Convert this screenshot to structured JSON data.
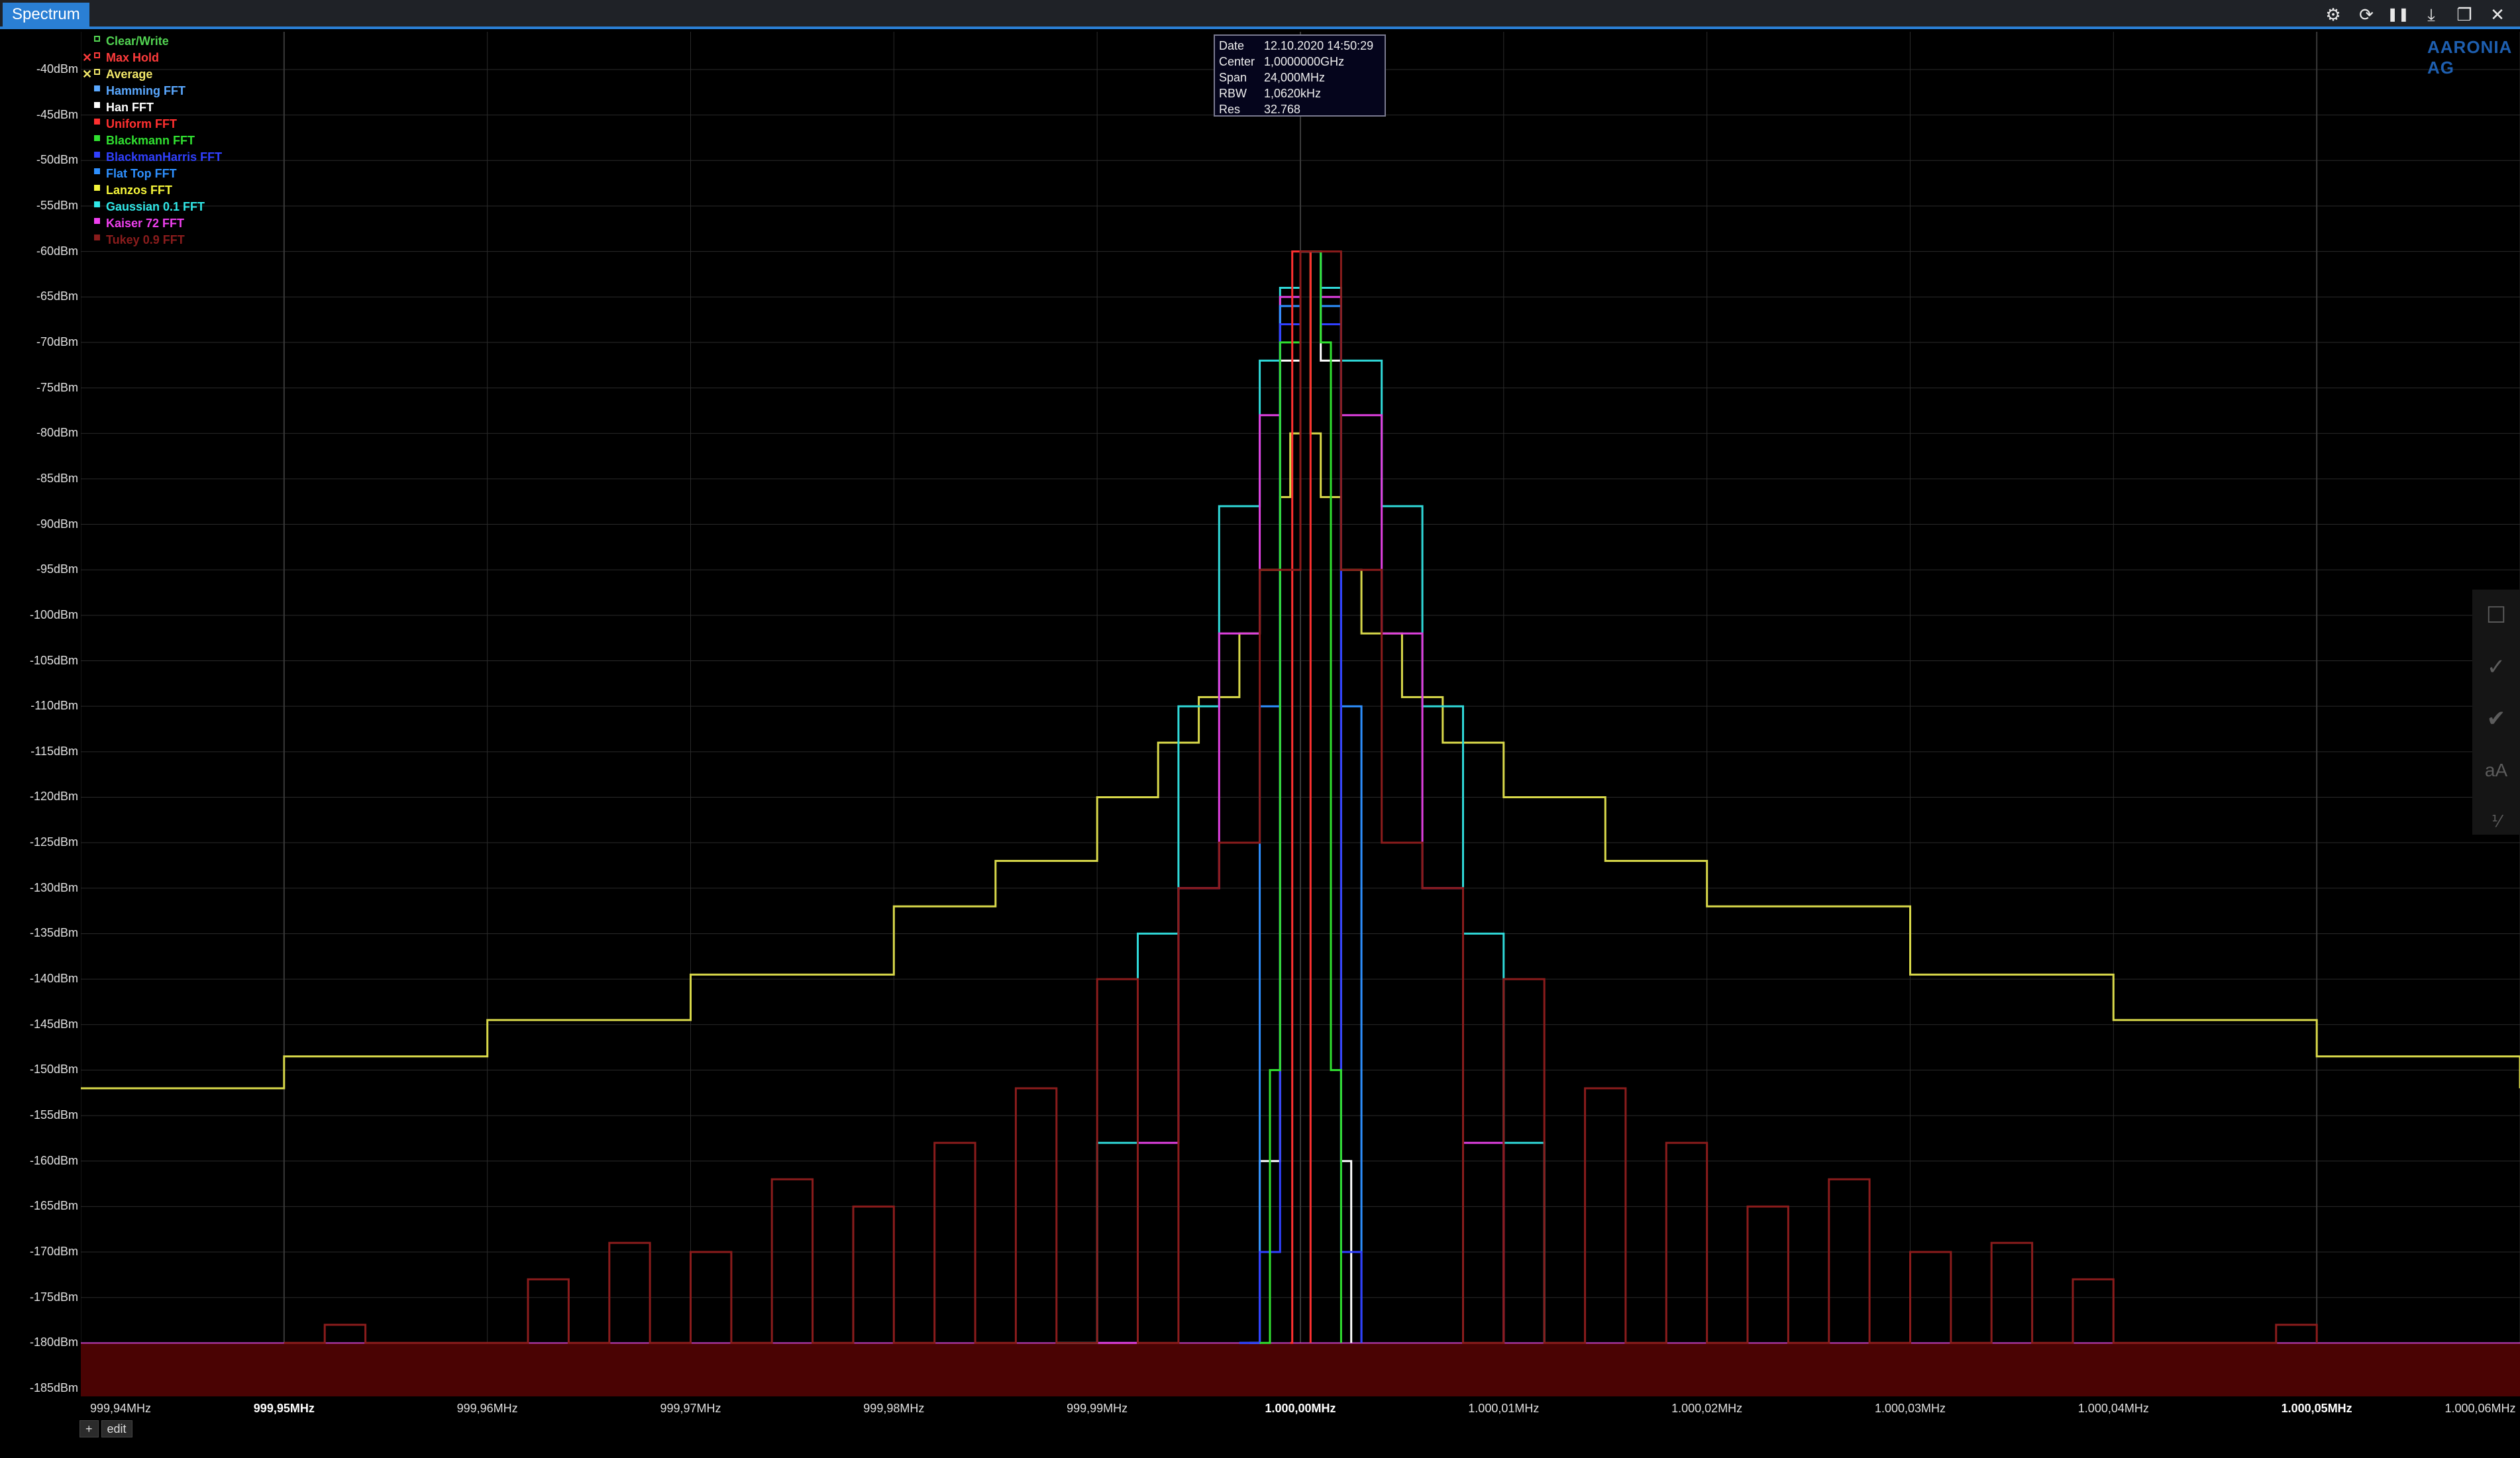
{
  "window": {
    "tab_label": "Spectrum"
  },
  "toolbar": {
    "buttons": [
      {
        "name": "settings-icon",
        "glyph": "⚙"
      },
      {
        "name": "refresh-icon",
        "glyph": "⟳"
      },
      {
        "name": "pause-icon",
        "glyph": "❚❚"
      },
      {
        "name": "download-icon",
        "glyph": "⤓"
      },
      {
        "name": "window-icon",
        "glyph": "❐"
      },
      {
        "name": "close-icon",
        "glyph": "✕"
      }
    ]
  },
  "info_box": {
    "rows": [
      {
        "key": "Date",
        "value": "12.10.2020 14:50:29"
      },
      {
        "key": "Center",
        "value": "1,0000000GHz"
      },
      {
        "key": "Span",
        "value": "24,000MHz"
      },
      {
        "key": "RBW",
        "value": "1,0620kHz"
      },
      {
        "key": "Res",
        "value": "32.768"
      }
    ]
  },
  "logo_text": "AARONIA AG",
  "side_tools": [
    "marker-box-icon",
    "trace-check-icon",
    "fill-check-icon",
    "font-size-icon",
    "fraction-icon"
  ],
  "bottom": {
    "add_label": "+",
    "edit_label": "edit"
  },
  "chart_data": {
    "type": "line",
    "ylim": [
      -187,
      -37
    ],
    "yticks": [
      "-40dBm",
      "-45dBm",
      "-50dBm",
      "-55dBm",
      "-60dBm",
      "-65dBm",
      "-70dBm",
      "-75dBm",
      "-80dBm",
      "-85dBm",
      "-90dBm",
      "-95dBm",
      "-100dBm",
      "-105dBm",
      "-110dBm",
      "-115dBm",
      "-120dBm",
      "-125dBm",
      "-130dBm",
      "-135dBm",
      "-140dBm",
      "-145dBm",
      "-150dBm",
      "-155dBm",
      "-160dBm",
      "-165dBm",
      "-170dBm",
      "-175dBm",
      "-180dBm",
      "-185dBm"
    ],
    "ytick_values": [
      -40,
      -45,
      -50,
      -55,
      -60,
      -65,
      -70,
      -75,
      -80,
      -85,
      -90,
      -95,
      -100,
      -105,
      -110,
      -115,
      -120,
      -125,
      -130,
      -135,
      -140,
      -145,
      -150,
      -155,
      -160,
      -165,
      -170,
      -175,
      -180,
      -185
    ],
    "xlim": [
      999.94,
      1000.06
    ],
    "xticks": [
      {
        "v": 999.94,
        "label": "999,94MHz",
        "bold": false
      },
      {
        "v": 999.95,
        "label": "999,95MHz",
        "bold": true
      },
      {
        "v": 999.96,
        "label": "999,96MHz",
        "bold": false
      },
      {
        "v": 999.97,
        "label": "999,97MHz",
        "bold": false
      },
      {
        "v": 999.98,
        "label": "999,98MHz",
        "bold": false
      },
      {
        "v": 999.99,
        "label": "999,99MHz",
        "bold": false
      },
      {
        "v": 1000.0,
        "label": "1.000,00MHz",
        "bold": true
      },
      {
        "v": 1000.01,
        "label": "1.000,01MHz",
        "bold": false
      },
      {
        "v": 1000.02,
        "label": "1.000,02MHz",
        "bold": false
      },
      {
        "v": 1000.03,
        "label": "1.000,03MHz",
        "bold": false
      },
      {
        "v": 1000.04,
        "label": "1.000,04MHz",
        "bold": false
      },
      {
        "v": 1000.05,
        "label": "1.000,05MHz",
        "bold": true
      },
      {
        "v": 1000.06,
        "label": "1.000,06MHz",
        "bold": false
      }
    ],
    "grid": true,
    "legend_position": "top-left",
    "floor_dbm": -180,
    "legend": [
      {
        "name": "Clear/Write",
        "color": "#52d452",
        "marker": "□"
      },
      {
        "name": "Max Hold",
        "color": "#ff3b3b",
        "marker": "□",
        "x": "✕"
      },
      {
        "name": "Average",
        "color": "#f2e86a",
        "marker": "□",
        "x": "✕"
      },
      {
        "name": "Hamming FFT",
        "color": "#5aa8ff",
        "marker": "■"
      },
      {
        "name": "Han FFT",
        "color": "#ffffff",
        "marker": "■"
      },
      {
        "name": "Uniform FFT",
        "color": "#ff3030",
        "marker": "■"
      },
      {
        "name": "Blackmann FFT",
        "color": "#30e030",
        "marker": "■"
      },
      {
        "name": "BlackmanHarris FFT",
        "color": "#3040ff",
        "marker": "■"
      },
      {
        "name": "Flat Top FFT",
        "color": "#2e90ff",
        "marker": "■"
      },
      {
        "name": "Lanzos FFT",
        "color": "#f5f53a",
        "marker": "■"
      },
      {
        "name": "Gaussian 0.1 FFT",
        "color": "#30e8e8",
        "marker": "■"
      },
      {
        "name": "Kaiser 72 FFT",
        "color": "#f040f0",
        "marker": "■"
      },
      {
        "name": "Tukey 0.9 FFT",
        "color": "#8a1c1c",
        "marker": "■"
      }
    ],
    "series": [
      {
        "name": "Lanzos FFT",
        "color": "#d8d84a",
        "x": [
          999.94,
          999.95,
          999.96,
          999.97,
          999.98,
          999.985,
          999.99,
          999.993,
          999.995,
          999.997,
          999.998,
          999.999,
          999.9995,
          1000.0,
          1000.0005,
          1000.001,
          1000.002,
          1000.003,
          1000.005,
          1000.007,
          1000.01,
          1000.015,
          1000.02,
          1000.03,
          1000.04,
          1000.05,
          1000.06
        ],
        "y": [
          -152,
          -148.5,
          -144.5,
          -139.5,
          -132,
          -127,
          -120,
          -114,
          -109,
          -102,
          -95,
          -87,
          -80,
          -60,
          -80,
          -87,
          -95,
          -102,
          -109,
          -114,
          -120,
          -127,
          -132,
          -139.5,
          -144.5,
          -148.5,
          -152
        ]
      },
      {
        "name": "Gaussian 0.1 FFT",
        "color": "#30d8d8",
        "x": [
          999.988,
          999.99,
          999.992,
          999.994,
          999.996,
          999.998,
          999.999,
          1000.0,
          1000.001,
          1000.002,
          1000.004,
          1000.006,
          1000.008,
          1000.01,
          1000.012
        ],
        "y": [
          -180,
          -158,
          -135,
          -110,
          -88,
          -72,
          -64,
          -60,
          -64,
          -72,
          -88,
          -110,
          -135,
          -158,
          -180
        ]
      },
      {
        "name": "Kaiser 72 FFT",
        "color": "#e040e0",
        "x": [
          999.99,
          999.992,
          999.994,
          999.996,
          999.998,
          999.999,
          1000.0,
          1000.001,
          1000.002,
          1000.004,
          1000.006,
          1000.008,
          1000.01
        ],
        "y": [
          -180,
          -158,
          -130,
          -102,
          -78,
          -65,
          -60,
          -65,
          -78,
          -102,
          -130,
          -158,
          -180
        ]
      },
      {
        "name": "Han FFT",
        "color": "#ffffff",
        "x": [
          999.9975,
          999.998,
          999.999,
          1000.0,
          1000.001,
          1000.002,
          1000.0025
        ],
        "y": [
          -180,
          -160,
          -72,
          -60,
          -72,
          -160,
          -180
        ]
      },
      {
        "name": "Flat Top FFT",
        "color": "#2e90ff",
        "x": [
          999.997,
          999.998,
          999.999,
          1000.0,
          1000.001,
          1000.002,
          1000.003
        ],
        "y": [
          -180,
          -110,
          -66,
          -60,
          -66,
          -110,
          -180
        ]
      },
      {
        "name": "BlackmanHarris FFT",
        "color": "#3040ff",
        "x": [
          999.997,
          999.998,
          999.999,
          1000.0,
          1000.001,
          1000.002,
          1000.003
        ],
        "y": [
          -180,
          -170,
          -68,
          -60,
          -68,
          -170,
          -180
        ]
      },
      {
        "name": "Blackmann FFT",
        "color": "#30e030",
        "x": [
          999.998,
          999.9985,
          999.999,
          1000.0,
          1000.001,
          1000.0015,
          1000.002
        ],
        "y": [
          -180,
          -150,
          -70,
          -60,
          -70,
          -150,
          -180
        ]
      },
      {
        "name": "Uniform FFT",
        "color": "#ff3030",
        "x": [
          999.9995,
          999.9996,
          1000.0,
          1000.0004,
          1000.0005
        ],
        "y": [
          -180,
          -60,
          -60,
          -60,
          -180
        ]
      },
      {
        "name": "Tukey 0.9 FFT",
        "color": "#8a1c1c",
        "x": [
          999.95,
          999.952,
          999.954,
          999.956,
          999.958,
          999.96,
          999.962,
          999.964,
          999.966,
          999.968,
          999.97,
          999.972,
          999.974,
          999.976,
          999.978,
          999.98,
          999.982,
          999.984,
          999.986,
          999.988,
          999.99,
          999.992,
          999.994,
          999.996,
          999.998,
          1000.0,
          1000.002,
          1000.004,
          1000.006,
          1000.008,
          1000.01,
          1000.012,
          1000.014,
          1000.016,
          1000.018,
          1000.02,
          1000.022,
          1000.024,
          1000.026,
          1000.028,
          1000.03,
          1000.032,
          1000.034,
          1000.036,
          1000.038,
          1000.04,
          1000.042,
          1000.044,
          1000.046,
          1000.048,
          1000.05
        ],
        "y": [
          -180,
          -178,
          -180,
          -180,
          -180,
          -180,
          -173,
          -180,
          -169,
          -180,
          -170,
          -180,
          -162,
          -180,
          -165,
          -180,
          -158,
          -180,
          -152,
          -180,
          -140,
          -180,
          -130,
          -125,
          -95,
          -60,
          -95,
          -125,
          -130,
          -180,
          -140,
          -180,
          -152,
          -180,
          -158,
          -180,
          -165,
          -180,
          -162,
          -180,
          -170,
          -180,
          -169,
          -180,
          -173,
          -180,
          -180,
          -180,
          -180,
          -178,
          -180
        ]
      }
    ]
  }
}
